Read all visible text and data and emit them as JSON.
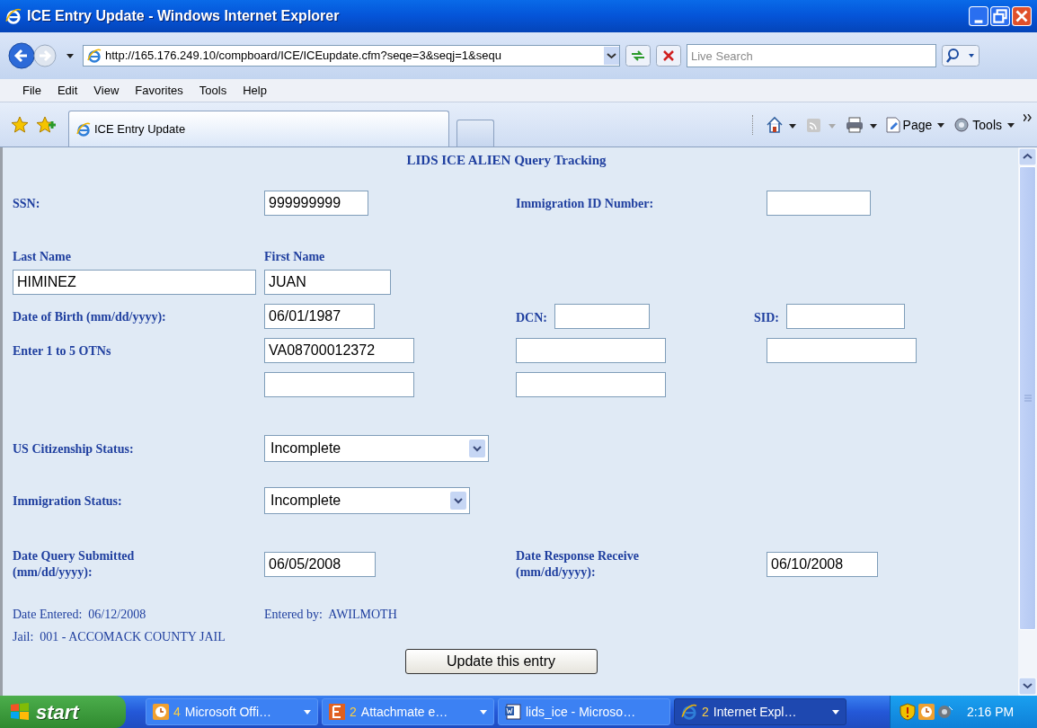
{
  "window": {
    "title": "ICE Entry Update - Windows Internet Explorer"
  },
  "address_bar": {
    "url": "http://165.176.249.10/compboard/ICE/ICEupdate.cfm?seqe=3&seqj=1&sequ"
  },
  "search": {
    "placeholder": "Live Search"
  },
  "menu": [
    "File",
    "Edit",
    "View",
    "Favorites",
    "Tools",
    "Help"
  ],
  "tabs": [
    {
      "label": "ICE Entry Update",
      "selected": true
    }
  ],
  "commands": [
    {
      "label": "Page"
    },
    {
      "label": "Tools"
    }
  ],
  "form": {
    "title": "LIDS ICE ALIEN Query Tracking",
    "ssn": {
      "label": "SSN:",
      "value": "999999999"
    },
    "immigration_id": {
      "label": "Immigration ID Number:"
    },
    "last_name": {
      "label": "Last Name",
      "value": "HIMINEZ"
    },
    "first_name": {
      "label": "First Name",
      "value": "JUAN"
    },
    "dob": {
      "label": "Date of Birth (mm/dd/yyyy):",
      "value": "06/01/1987"
    },
    "dcn": {
      "label": "DCN:"
    },
    "sid": {
      "label": "SID:"
    },
    "otns": {
      "label": "Enter 1 to 5 OTNs",
      "fields": [
        {
          "kind": "filled",
          "value": "VA08700012372"
        },
        {
          "kind": "empty"
        },
        {
          "kind": "empty"
        },
        {
          "kind": "empty"
        },
        {
          "kind": "empty"
        }
      ]
    },
    "citizenship": {
      "label": "US Citizenship Status:",
      "value": "Incomplete"
    },
    "immigration_status": {
      "label": "Immigration Status:",
      "value": "Incomplete"
    },
    "date_submitted": {
      "label": "Date Query Submitted",
      "label_2": "(mm/dd/yyyy):",
      "value": "06/05/2008"
    },
    "date_received": {
      "label": "Date Response Receive",
      "label_2": "(mm/dd/yyyy):",
      "value": "06/10/2008"
    },
    "date_entered": "Date Entered:  06/12/2008",
    "entered_by": "Entered by:  AWILMOTH",
    "jail": "Jail:  001 - ACCOMACK COUNTY JAIL",
    "submit": "Update this entry"
  },
  "taskbar": {
    "start": "start",
    "items": [
      {
        "count": "4",
        "label": "Microsoft Offi…",
        "selected": false
      },
      {
        "count": "2",
        "label": "Attachmate e…",
        "selected": false
      },
      {
        "label": "lids_ice - Microso…",
        "selected": false
      },
      {
        "count": "2",
        "label": "Internet Expl…",
        "selected": true
      }
    ],
    "clock": "2:16 PM"
  }
}
